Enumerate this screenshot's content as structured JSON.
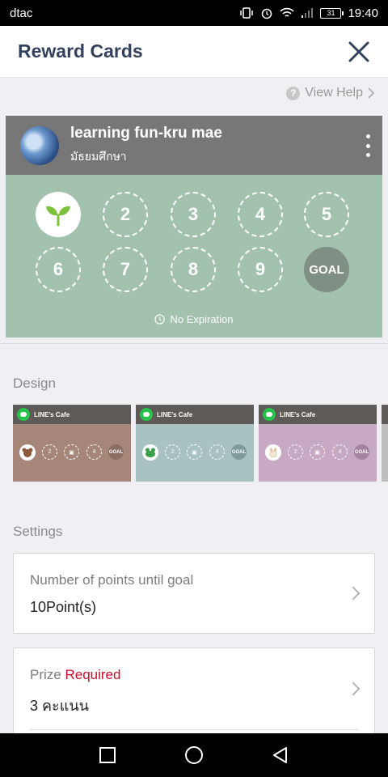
{
  "status_bar": {
    "carrier": "dtac",
    "battery": "31",
    "time": "19:40"
  },
  "header": {
    "title": "Reward Cards"
  },
  "help": {
    "label": "View Help"
  },
  "card": {
    "name": "learning fun-kru mae",
    "subtitle": "มัธยมศึกษา",
    "stamps": [
      "2",
      "3",
      "4",
      "5",
      "6",
      "7",
      "8",
      "9"
    ],
    "goal_label": "GOAL",
    "expiration": "No Expiration"
  },
  "design": {
    "section_title": "Design",
    "cafe_name": "LINE's Cafe",
    "cafe_sub": "Cafe",
    "dot_labels": [
      "2",
      "4"
    ],
    "goal_label": "GOAL",
    "colors": [
      "#a7867a",
      "#a8c2c2",
      "#c8a9c4"
    ]
  },
  "settings": {
    "section_title": "Settings",
    "points": {
      "label": "Number of points until goal",
      "value": "10Point(s)"
    },
    "prize": {
      "label": "Prize",
      "required": "Required",
      "value": "3 คะแนน"
    }
  },
  "icons": {
    "close": "close-icon",
    "help": "help-icon",
    "menu": "more-vert-icon",
    "sprout": "sprout-icon",
    "clock": "clock-icon",
    "nav": [
      "square-icon",
      "circle-icon",
      "triangle-back-icon"
    ]
  }
}
